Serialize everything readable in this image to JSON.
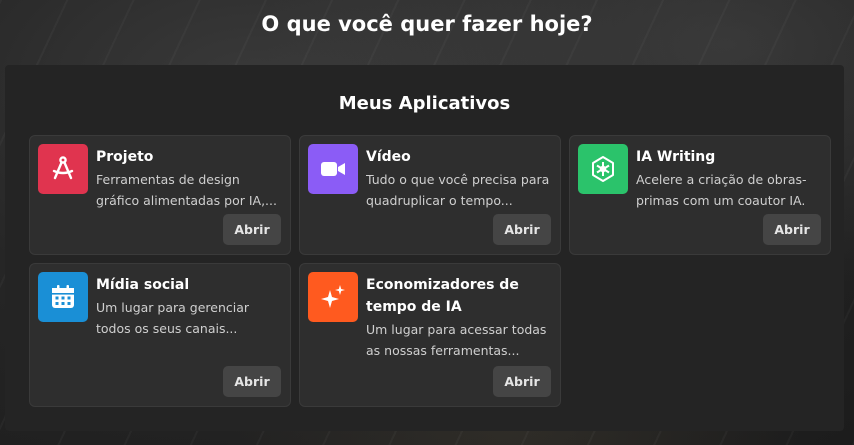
{
  "header": {
    "title": "O que você quer fazer hoje?"
  },
  "apps_section": {
    "title": "Meus Aplicativos",
    "open_label": "Abrir",
    "apps": [
      {
        "title": "Projeto",
        "description": "Ferramentas de design gráfico alimentadas por IA,...",
        "icon": "drafting-compass-icon",
        "color": "#e0344f"
      },
      {
        "title": "Vídeo",
        "description": "Tudo o que você precisa para quadruplicar o tempo...",
        "icon": "video-camera-icon",
        "color": "#8b5cf6"
      },
      {
        "title": "IA Writing",
        "description": "Acelere a criação de obras-primas com um coautor IA.",
        "icon": "ai-writing-icon",
        "color": "#2bc36b"
      },
      {
        "title": "Mídia social",
        "description": "Um lugar para gerenciar todos os seus canais...",
        "icon": "calendar-icon",
        "color": "#1a8fd6"
      },
      {
        "title": "Economizadores de tempo de IA",
        "description": "Um lugar para acessar todas as nossas ferramentas...",
        "icon": "sparkles-icon",
        "color": "#ff5a1f"
      }
    ]
  }
}
